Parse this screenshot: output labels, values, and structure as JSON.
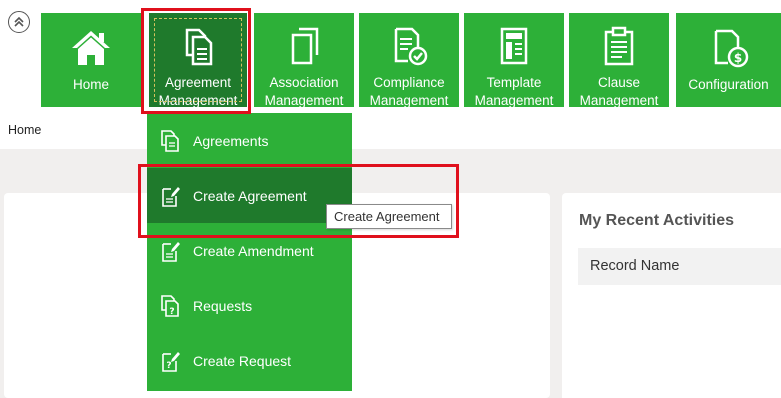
{
  "ribbon": [
    {
      "id": "home",
      "label": "Home",
      "icon": "home-icon"
    },
    {
      "id": "agreement",
      "label": "Agreement\nManagement",
      "icon": "agreement-documents-icon",
      "active": true
    },
    {
      "id": "association",
      "label": "Association\nManagement",
      "icon": "association-documents-icon"
    },
    {
      "id": "compliance",
      "label": "Compliance\nManagement",
      "icon": "compliance-check-icon"
    },
    {
      "id": "template",
      "label": "Template\nManagement",
      "icon": "template-icon"
    },
    {
      "id": "clause",
      "label": "Clause\nManagement",
      "icon": "clipboard-icon"
    },
    {
      "id": "config",
      "label": "Configuration",
      "icon": "configuration-cost-icon"
    }
  ],
  "ribbon_labels": {
    "home": "Home",
    "agreement_1": "Agreement",
    "agreement_2": "Management",
    "association_1": "Association",
    "association_2": "Management",
    "compliance_1": "Compliance",
    "compliance_2": "Management",
    "template_1": "Template",
    "template_2": "Management",
    "clause_1": "Clause",
    "clause_2": "Management",
    "config": "Configuration"
  },
  "breadcrumb": "Home",
  "dropdown": {
    "items": [
      {
        "label": "Agreements",
        "icon": "agreements-icon"
      },
      {
        "label": "Create Agreement",
        "icon": "create-agreement-icon",
        "active": true
      },
      {
        "label": "Create Amendment",
        "icon": "create-amendment-icon"
      },
      {
        "label": "Requests",
        "icon": "requests-icon"
      },
      {
        "label": "Create Request",
        "icon": "create-request-icon"
      }
    ]
  },
  "tooltip": "Create Agreement",
  "recent": {
    "title": "My Recent Activities",
    "column_header": "Record Name"
  },
  "colors": {
    "ribbon_green": "#2db038",
    "active_green": "#1f7a2c",
    "highlight_red": "#e0101c",
    "content_bg": "#f1efee"
  }
}
